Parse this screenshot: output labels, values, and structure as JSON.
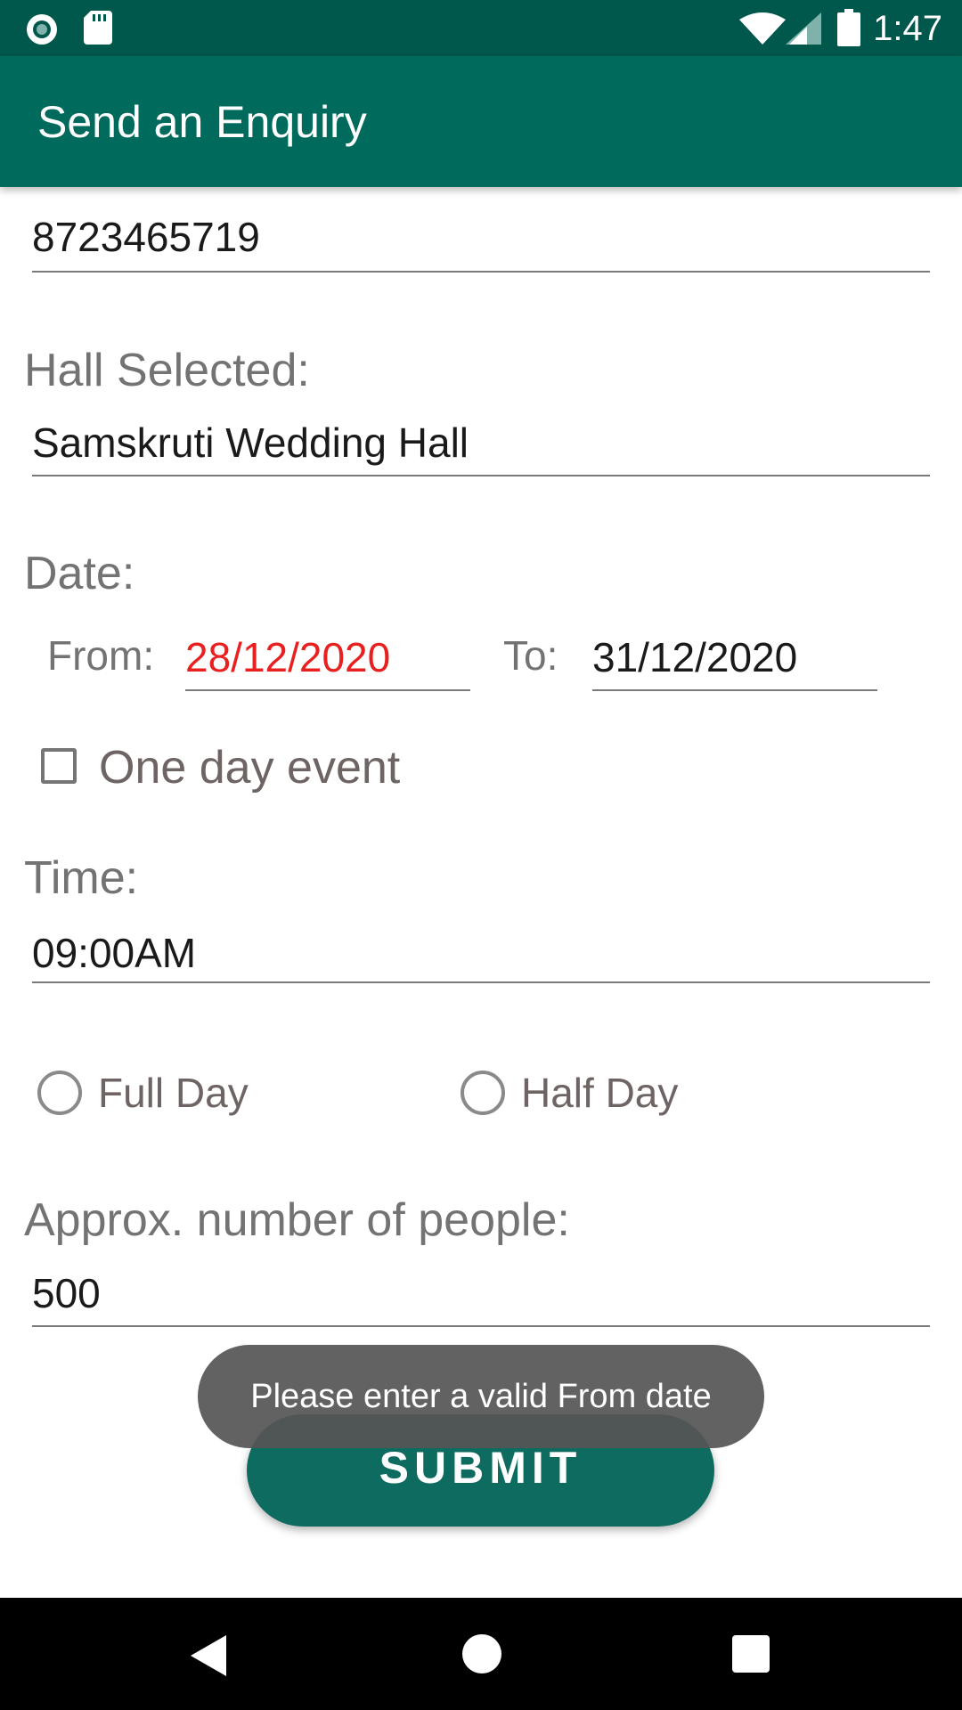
{
  "status_bar": {
    "time": "1:47",
    "icons": [
      "radio-dot-icon",
      "sd-card-icon",
      "wifi-icon",
      "cell-signal-icon",
      "battery-icon"
    ],
    "background": "#00574b"
  },
  "app_bar": {
    "title": "Send an Enquiry",
    "background": "#006b5d"
  },
  "form": {
    "phone": {
      "value": "8723465719"
    },
    "hall": {
      "label": "Hall Selected:",
      "value": "Samskruti Wedding Hall"
    },
    "date": {
      "label": "Date:",
      "from_label": "From:",
      "from_value": "28/12/2020",
      "from_color": "#e8201f",
      "to_label": "To:",
      "to_value": "31/12/2020"
    },
    "one_day_event": {
      "label": "One day event",
      "checked": false
    },
    "time": {
      "label": "Time:",
      "value": "09:00AM"
    },
    "duration": {
      "full_day": {
        "label": "Full Day",
        "selected": false
      },
      "half_day": {
        "label": "Half Day",
        "selected": false
      }
    },
    "people": {
      "label": "Approx. number of people:",
      "value": "500"
    },
    "submit_label": "SUBMIT",
    "accent": "#0e6b5f"
  },
  "toast": {
    "message": "Please enter a valid From date"
  },
  "nav_bar": {
    "buttons": [
      "back-icon",
      "home-icon",
      "recents-icon"
    ]
  }
}
